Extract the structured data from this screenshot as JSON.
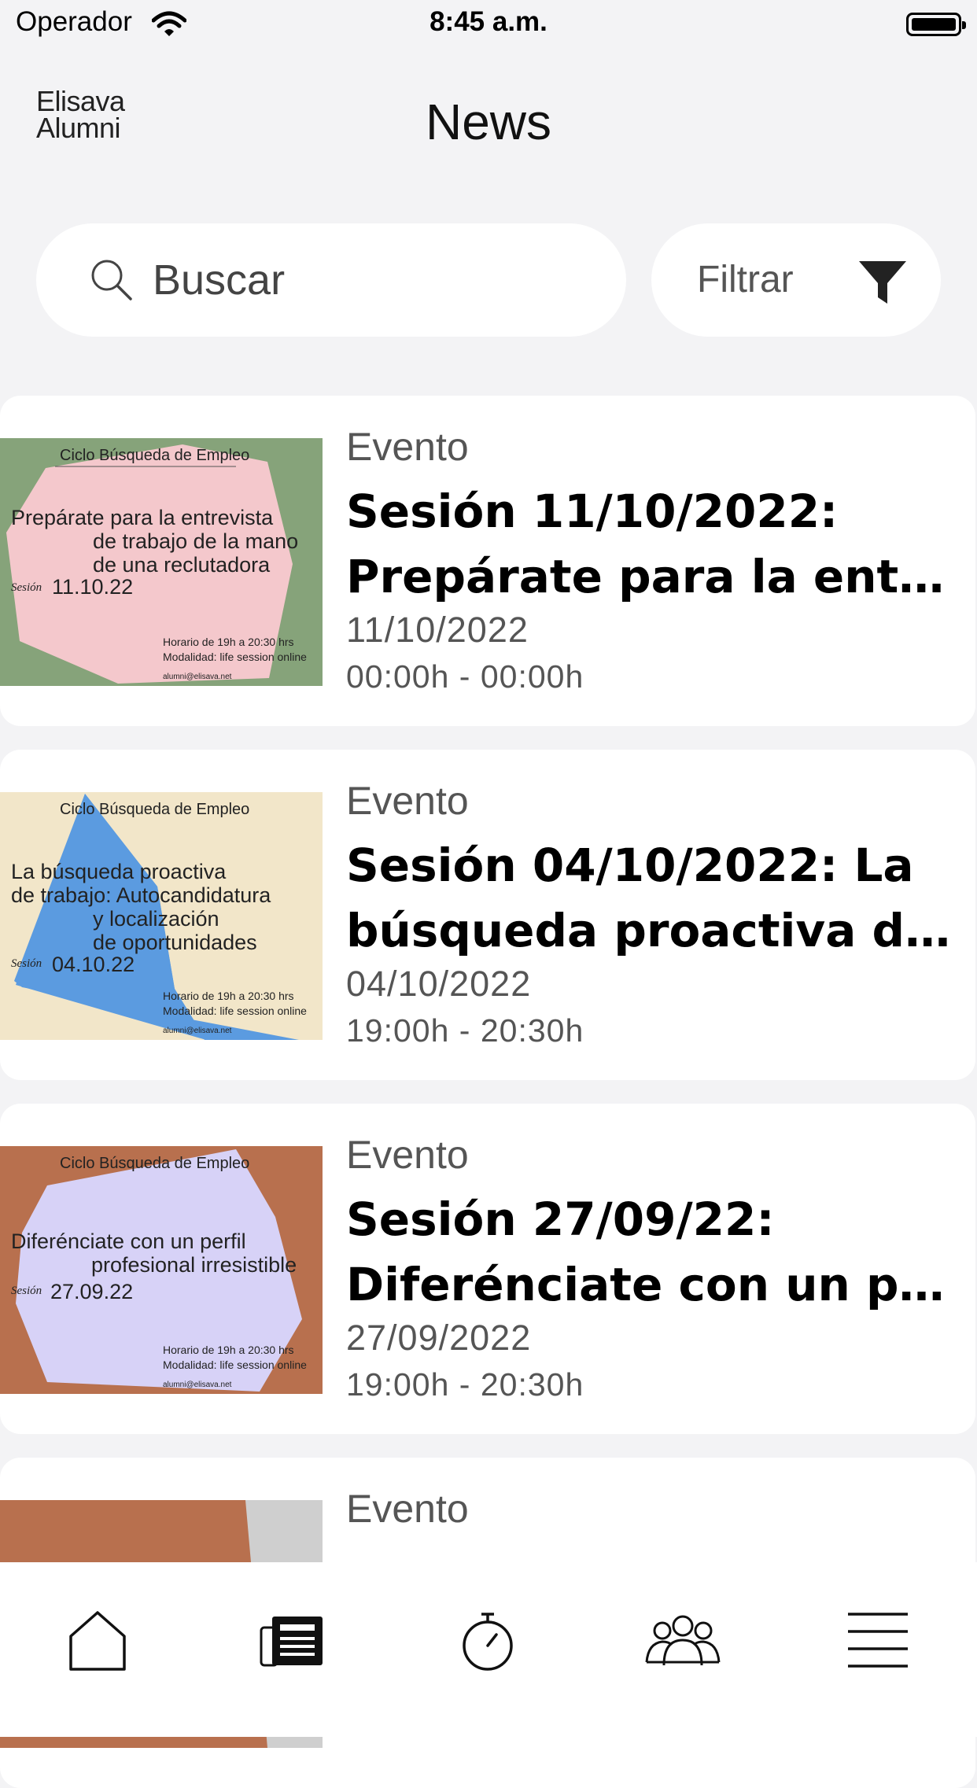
{
  "status": {
    "carrier": "Operador",
    "time": "8:45 a.m."
  },
  "header": {
    "logo_line1": "Elisava",
    "logo_line2": "Alumni",
    "title": "News"
  },
  "search": {
    "placeholder": "Buscar"
  },
  "filter": {
    "label": "Filtrar"
  },
  "cards": [
    {
      "category": "Evento",
      "title_line1": "Sesión 11/10/2022:",
      "title_line2": "Prepárate para la entr...",
      "date": "11/10/2022",
      "hours": "00:00h - 00:00h",
      "image": {
        "background": "#86a37a",
        "shape": "#f4c8cc",
        "series": "Ciclo Búsqueda de Empleo",
        "lines": [
          "Prepárate para la entrevista",
          "de trabajo de la mano",
          "de una reclutadora"
        ],
        "session_label": "Sesión",
        "session_date": "11.10.22",
        "schedule": "Horario de 19h a 20:30 hrs",
        "mode": "Modalidad: life session online",
        "email": "alumni@elisava.net"
      }
    },
    {
      "category": "Evento",
      "title_line1": "Sesión 04/10/2022: La",
      "title_line2": "búsqueda proactiva d...",
      "date": "04/10/2022",
      "hours": "19:00h - 20:30h",
      "image": {
        "background": "#f2e6c9",
        "shape": "#5b9be0",
        "series": "Ciclo Búsqueda de Empleo",
        "lines": [
          "La búsqueda proactiva",
          "de trabajo: Autocandidatura",
          "y localización",
          "de oportunidades"
        ],
        "session_label": "Sesión",
        "session_date": "04.10.22",
        "schedule": "Horario de 19h a 20:30 hrs",
        "mode": "Modalidad: life session online",
        "email": "alumni@elisava.net"
      }
    },
    {
      "category": "Evento",
      "title_line1": "Sesión 27/09/22:",
      "title_line2": "Diferénciate con un pe...",
      "date": "27/09/2022",
      "hours": "19:00h - 20:30h",
      "image": {
        "background": "#b8704e",
        "shape": "#d7d2f7",
        "series": "Ciclo Búsqueda de Empleo",
        "lines": [
          "Diferénciate con un perfil",
          "profesional irresistible"
        ],
        "session_label": "Sesión",
        "session_date": "27.09.22",
        "schedule": "Horario de 19h a 20:30 hrs",
        "mode": "Modalidad: life session online",
        "email": "alumni@elisava.net"
      }
    },
    {
      "category": "Evento",
      "title_line1": "",
      "title_line2": "",
      "date": "",
      "hours": "",
      "image": {
        "background": "#b8704e",
        "shape": "#cfcfcf"
      }
    }
  ],
  "tabbar": {
    "items": [
      {
        "icon": "home-icon"
      },
      {
        "icon": "news-icon"
      },
      {
        "icon": "stopwatch-icon"
      },
      {
        "icon": "community-icon"
      },
      {
        "icon": "menu-icon"
      }
    ]
  }
}
